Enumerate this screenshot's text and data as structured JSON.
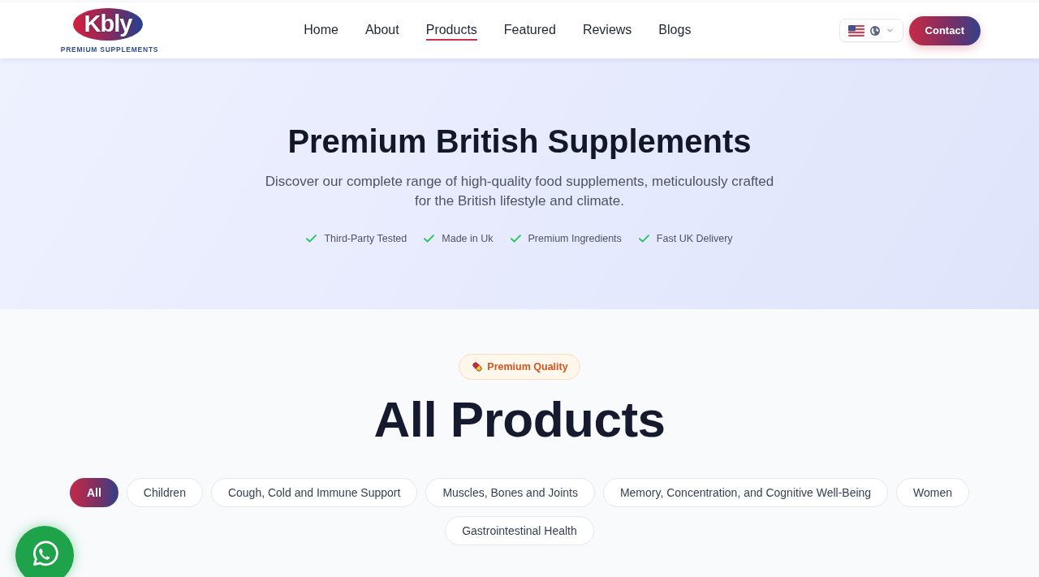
{
  "header": {
    "logo": {
      "name": "Kbly",
      "tagline": "PREMIUM SUPPLEMENTS"
    },
    "nav": [
      {
        "label": "Home",
        "selected": false
      },
      {
        "label": "About",
        "selected": false
      },
      {
        "label": "Products",
        "selected": true
      },
      {
        "label": "Featured",
        "selected": false
      },
      {
        "label": "Reviews",
        "selected": false
      },
      {
        "label": "Blogs",
        "selected": false
      }
    ],
    "contact_button": "Contact"
  },
  "hero": {
    "title": "Premium British Supplements",
    "subtitle": "Discover our complete range of high-quality food supplements, meticulously crafted for the British lifestyle and climate.",
    "features": [
      "Third-Party Tested",
      "Made in Uk",
      "Premium Ingredients",
      "Fast UK Delivery"
    ]
  },
  "products": {
    "badge": "Premium Quality",
    "title": "All Products",
    "categories": [
      {
        "label": "All",
        "selected": true
      },
      {
        "label": "Children",
        "selected": false
      },
      {
        "label": "Cough, Cold and Immune Support",
        "selected": false
      },
      {
        "label": "Muscles, Bones and Joints",
        "selected": false
      },
      {
        "label": "Memory, Concentration, and Cognitive Well-Being",
        "selected": false
      },
      {
        "label": "Women",
        "selected": false
      },
      {
        "label": "Gastrointestinal Health",
        "selected": false
      }
    ]
  }
}
